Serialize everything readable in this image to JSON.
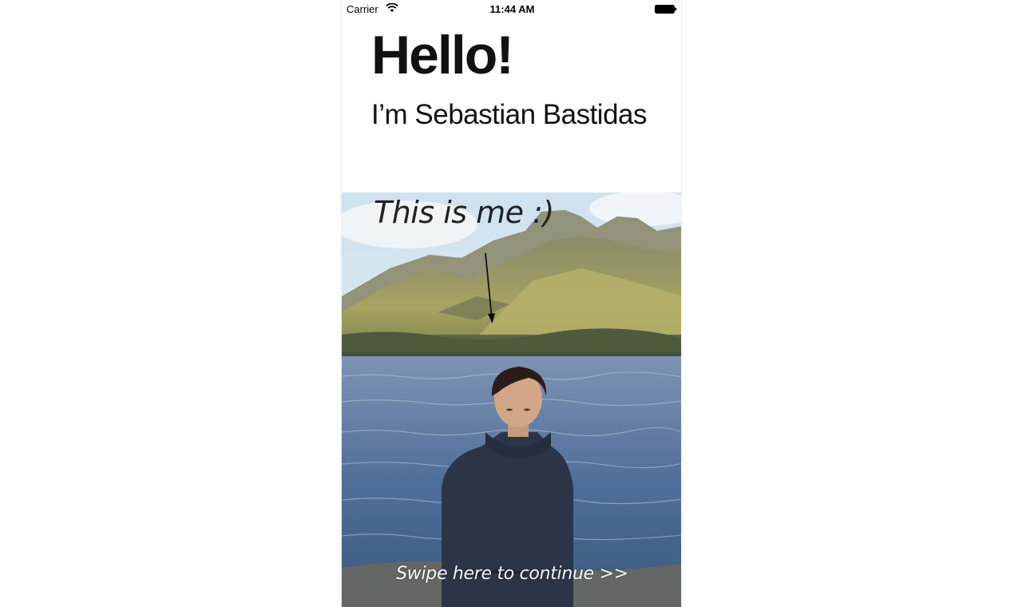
{
  "status_bar": {
    "carrier": "Carrier",
    "time": "11:44 AM",
    "wifi_icon": "wifi-icon",
    "battery_icon": "battery-icon"
  },
  "intro": {
    "greeting": "Hello!",
    "name_line": "I’m Sebastian Bastidas"
  },
  "photo": {
    "caption": "This is me :)",
    "arrow_icon": "arrow-down-icon"
  },
  "footer": {
    "swipe_hint": "Swipe here to continue >>"
  }
}
